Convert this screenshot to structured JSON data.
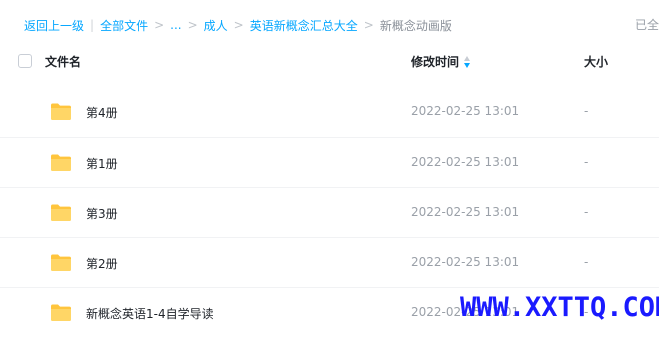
{
  "breadcrumb": {
    "back": "返回上一级",
    "all_files": "全部文件",
    "ellipsis": "...",
    "level1": "成人",
    "level2": "英语新概念汇总大全",
    "current": "新概念动画版"
  },
  "status": {
    "loaded_text": "已全"
  },
  "table": {
    "headers": {
      "name": "文件名",
      "modified": "修改时间",
      "size": "大小"
    },
    "rows": [
      {
        "name": "第4册",
        "modified": "2022-02-25 13:01",
        "size": "-"
      },
      {
        "name": "第1册",
        "modified": "2022-02-25 13:01",
        "size": "-"
      },
      {
        "name": "第3册",
        "modified": "2022-02-25 13:01",
        "size": "-"
      },
      {
        "name": "第2册",
        "modified": "2022-02-25 13:01",
        "size": "-"
      },
      {
        "name": "新概念英语1-4自学导读",
        "modified": "2022-02-25 13:01",
        "size": "-"
      }
    ]
  },
  "watermark": {
    "text": "WWW.XXTTQ.COM",
    "color": "#1a1aff"
  },
  "colors": {
    "accent": "#06a7ff",
    "folder": "#ffc53d"
  },
  "icons": {
    "folder": "folder-icon",
    "sort": "sort-descending-icon",
    "checkbox": "checkbox-icon"
  }
}
